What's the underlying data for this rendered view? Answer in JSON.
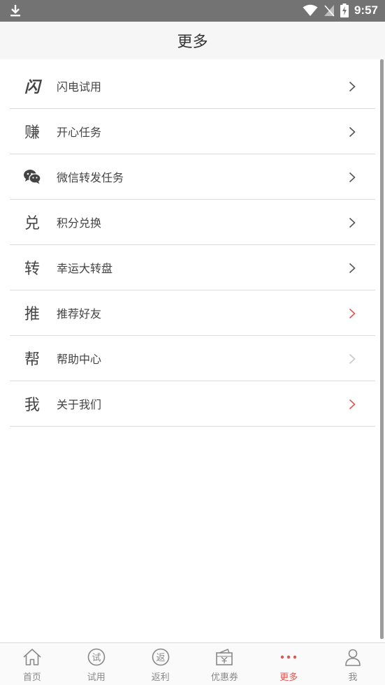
{
  "status_bar": {
    "time": "9:57"
  },
  "header": {
    "title": "更多"
  },
  "menu": [
    {
      "glyph": "闪",
      "label": "闪电试用"
    },
    {
      "glyph": "赚",
      "label": "开心任务"
    },
    {
      "glyph": "",
      "label": "微信转发任务",
      "icon": "wechat-icon"
    },
    {
      "glyph": "兑",
      "label": "积分兑换"
    },
    {
      "glyph": "转",
      "label": "幸运大转盘"
    },
    {
      "glyph": "推",
      "label": "推荐好友"
    },
    {
      "glyph": "帮",
      "label": "帮助中心"
    },
    {
      "glyph": "我",
      "label": "关于我们"
    }
  ],
  "tabs": [
    {
      "label": "首页",
      "icon": "home-icon"
    },
    {
      "label": "试用",
      "icon": "trial-icon",
      "glyph": "试"
    },
    {
      "label": "返利",
      "icon": "rebate-icon",
      "glyph": "返"
    },
    {
      "label": "优惠券",
      "icon": "coupon-icon"
    },
    {
      "label": "更多",
      "icon": "more-dots-icon",
      "active": true
    },
    {
      "label": "我",
      "icon": "user-icon"
    }
  ],
  "colors": {
    "accent": "#e0564f",
    "chevron_gray": "#555555",
    "chevron_red": "#e0564f",
    "chevron_light": "#c8c8c8"
  }
}
